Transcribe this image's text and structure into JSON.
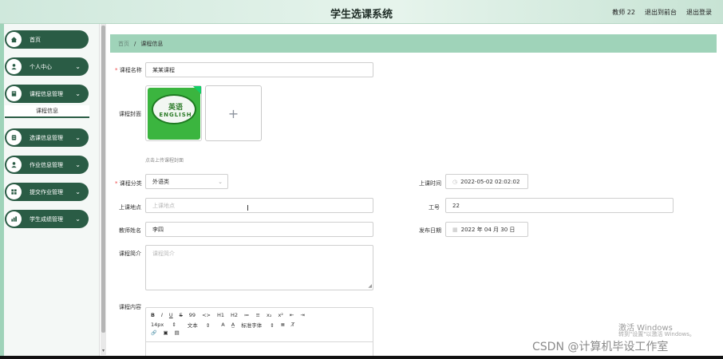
{
  "header": {
    "title": "学生选课系统",
    "user": "教师 22",
    "front_link": "退出到前台",
    "logout_link": "退出登录"
  },
  "sidebar": {
    "items": [
      {
        "label": "首页",
        "icon": "home-icon"
      },
      {
        "label": "个人中心",
        "icon": "user-icon"
      },
      {
        "label": "课程信息管理",
        "icon": "book-icon"
      },
      {
        "label": "选课信息管理",
        "icon": "document-icon"
      },
      {
        "label": "作业信息管理",
        "icon": "user-icon"
      },
      {
        "label": "提交作业管理",
        "icon": "grid-icon"
      },
      {
        "label": "学生成绩管理",
        "icon": "chart-icon"
      }
    ],
    "sub_item": "课程信息"
  },
  "breadcrumb": {
    "home": "首页",
    "separator": "/",
    "current": "课程信息"
  },
  "form": {
    "course_name": {
      "label": "课程名称",
      "value": "某某课程"
    },
    "cover": {
      "label": "课程封面",
      "image_text1": "英语",
      "image_text2": "ENGLISH",
      "upload_plus": "+",
      "hint": "点击上传课程封面"
    },
    "category": {
      "label": "课程分类",
      "value": "外语类",
      "arrow": "⌄"
    },
    "class_time": {
      "label": "上课时间",
      "value": "2022-05-02 02:02:02"
    },
    "location": {
      "label": "上课地点",
      "placeholder": "上课地点"
    },
    "staff_id": {
      "label": "工号",
      "value": "22"
    },
    "teacher": {
      "label": "教师姓名",
      "value": "李四"
    },
    "publish_date": {
      "label": "发布日期",
      "value": "2022 年 04 月 30 日"
    },
    "intro": {
      "label": "课程简介",
      "placeholder": "课程简介"
    },
    "content": {
      "label": "课程内容"
    }
  },
  "editor": {
    "row1": [
      "B",
      "I",
      "U",
      "S",
      "99",
      "<>",
      "H1",
      "H2",
      "≔",
      "≡",
      "x₂",
      "x²",
      "⇤",
      "⇥"
    ],
    "font_size": "14px",
    "text_type": "文本",
    "font_family": "标准字体",
    "row2_icons": [
      "A",
      "A̲",
      "≣",
      "T̸"
    ],
    "row3": [
      "🔗",
      "▣",
      "▤"
    ]
  },
  "watermark": {
    "line1": "激活 Windows",
    "line2": "转到\"设置\"以激活 Windows。"
  },
  "credit": "CSDN @计算机毕设工作室",
  "colors": {
    "accent": "#2a5c45",
    "breadcrumb_bg": "#9fd3b9",
    "header_bg": "#cfe8dc"
  }
}
